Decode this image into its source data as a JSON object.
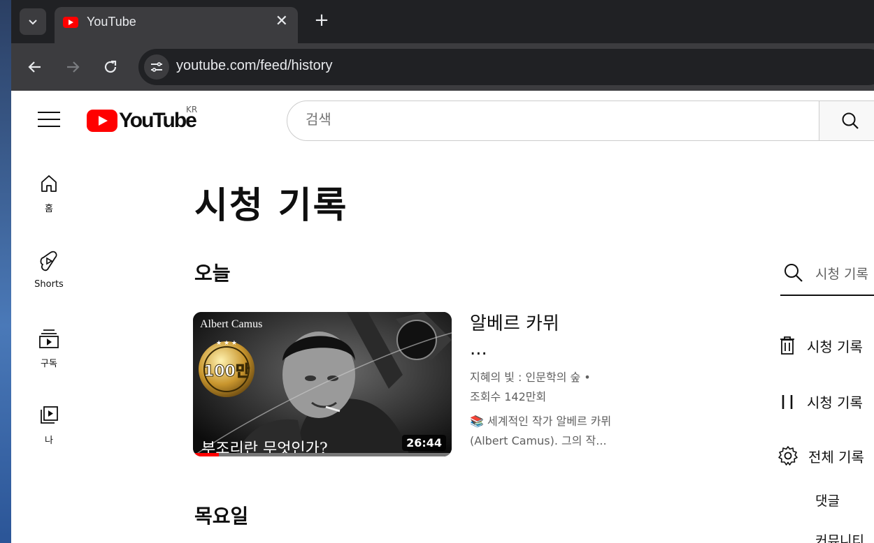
{
  "browser": {
    "tab_title": "YouTube",
    "url": "youtube.com/feed/history"
  },
  "header": {
    "logo_text": "YouTube",
    "country_code": "KR",
    "search_placeholder": "검색"
  },
  "sidebar": {
    "items": [
      {
        "label": "홈",
        "icon": "home-icon"
      },
      {
        "label": "Shorts",
        "icon": "shorts-icon"
      },
      {
        "label": "구독",
        "icon": "subscriptions-icon"
      },
      {
        "label": "나",
        "icon": "you-icon"
      }
    ]
  },
  "main": {
    "page_title": "시청 기록",
    "sections": [
      {
        "heading": "오늘",
        "videos": [
          {
            "title": "알베르 카뮈 ...",
            "channel": "지혜의 빛 : 인문학의 숲 •",
            "views": "조회수 142만회",
            "description": "📚 세계적인 작가 알베르 카뮈(Albert Camus). 그의 작...",
            "duration": "26:44",
            "thumb_top_text": "Albert Camus",
            "thumb_badge": "100만",
            "thumb_caption": "부조리란 무엇인가?",
            "watched_fraction": 0.1
          }
        ]
      },
      {
        "heading": "목요일"
      }
    ]
  },
  "right_panel": {
    "search_placeholder": "시청 기록",
    "actions": [
      {
        "label": "시청 기록",
        "icon": "trash-icon"
      },
      {
        "label": "시청 기록",
        "icon": "pause-icon"
      },
      {
        "label": "전체 기록",
        "icon": "gear-icon"
      }
    ],
    "sub_items": [
      "댓글",
      "커뮤니티"
    ]
  },
  "colors": {
    "brand_red": "#ff0000",
    "browser_dark": "#202124"
  }
}
